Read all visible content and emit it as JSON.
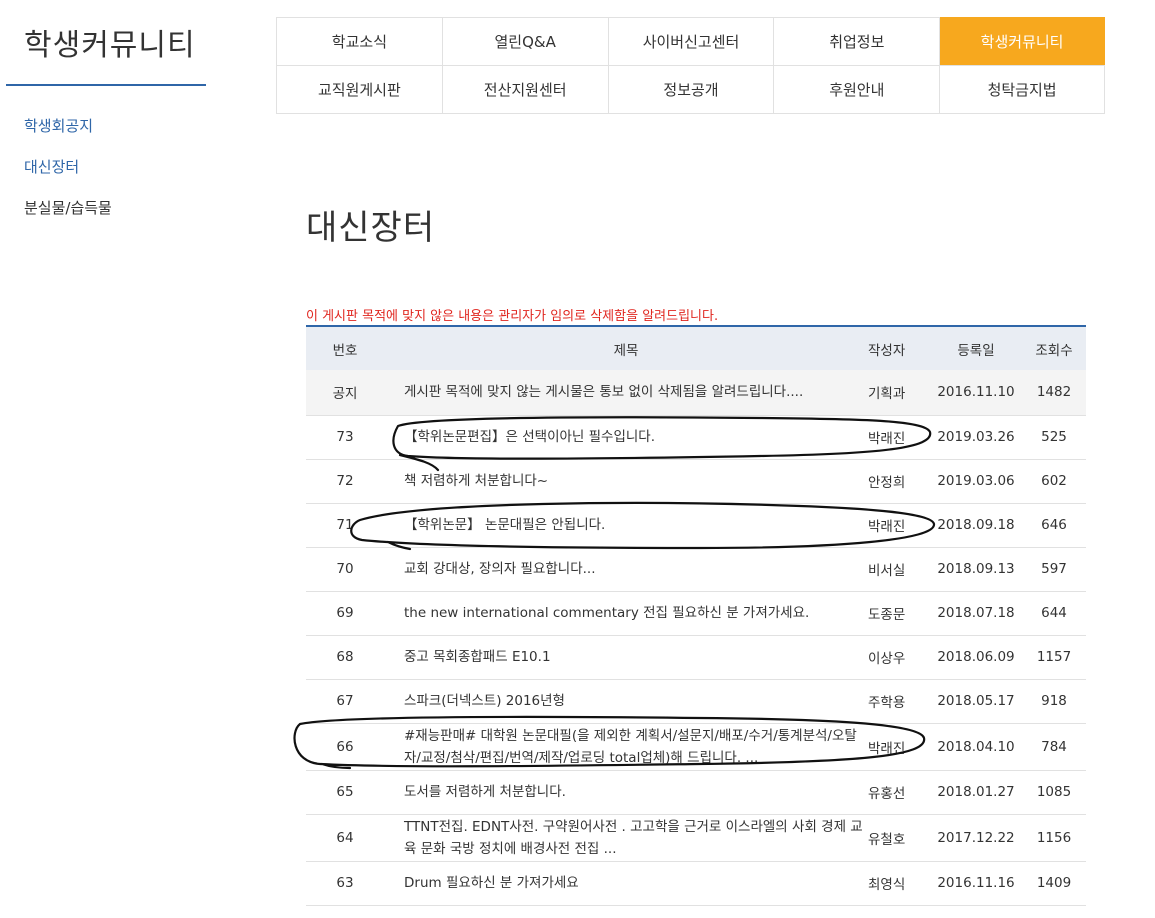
{
  "sidebar": {
    "title": "학생커뮤니티",
    "items": [
      {
        "label": "학생회공지"
      },
      {
        "label": "대신장터"
      },
      {
        "label": "분실물/습득물"
      }
    ]
  },
  "topnav": {
    "row1": [
      {
        "label": "학교소식"
      },
      {
        "label": "열린Q&A"
      },
      {
        "label": "사이버신고센터"
      },
      {
        "label": "취업정보"
      },
      {
        "label": "학생커뮤니티"
      }
    ],
    "row2": [
      {
        "label": "교직원게시판"
      },
      {
        "label": "전산지원센터"
      },
      {
        "label": "정보공개"
      },
      {
        "label": "후원안내"
      },
      {
        "label": "청탁금지법"
      }
    ],
    "active_index": 4
  },
  "page": {
    "title": "대신장터",
    "notice": "이 게시판 목적에 맞지 않은 내용은 관리자가 임의로 삭제함을 알려드립니다."
  },
  "table": {
    "headers": {
      "no": "번호",
      "title": "제목",
      "writer": "작성자",
      "date": "등록일",
      "views": "조회수"
    },
    "rows": [
      {
        "no": "공지",
        "title": "게시판 목적에 맞지 않는 게시물은 통보 없이 삭제됨을 알려드립니다....",
        "writer": "기획과",
        "date": "2016.11.10",
        "views": "1482"
      },
      {
        "no": "73",
        "title": "【학위논문편집】은 선택이아닌 필수입니다.",
        "writer": "박래진",
        "date": "2019.03.26",
        "views": "525"
      },
      {
        "no": "72",
        "title": "책 저렴하게 처분합니다~",
        "writer": "안정희",
        "date": "2019.03.06",
        "views": "602"
      },
      {
        "no": "71",
        "title": "【학위논문】 논문대필은 안됩니다.",
        "writer": "박래진",
        "date": "2018.09.18",
        "views": "646"
      },
      {
        "no": "70",
        "title": "교회 강대상, 장의자 필요합니다...",
        "writer": "비서실",
        "date": "2018.09.13",
        "views": "597"
      },
      {
        "no": "69",
        "title": "the new international commentary 전집 필요하신 분 가져가세요.",
        "writer": "도종문",
        "date": "2018.07.18",
        "views": "644"
      },
      {
        "no": "68",
        "title": "중고 목회종합패드 E10.1",
        "writer": "이상우",
        "date": "2018.06.09",
        "views": "1157"
      },
      {
        "no": "67",
        "title": "스파크(더넥스트) 2016년형",
        "writer": "주학용",
        "date": "2018.05.17",
        "views": "918"
      },
      {
        "no": "66",
        "title": "#재능판매# 대학원 논문대필(을 제외한 계획서/설문지/배포/수거/통계분석/오탈자/교정/첨삭/편집/번역/제작/업로딩 total업체)해 드립니다. ...",
        "writer": "박래진",
        "date": "2018.04.10",
        "views": "784"
      },
      {
        "no": "65",
        "title": "도서를 저렴하게 처분합니다.",
        "writer": "유홍선",
        "date": "2018.01.27",
        "views": "1085"
      },
      {
        "no": "64",
        "title": "TTNT전집. EDNT사전. 구약원어사전 . 고고학을 근거로 이스라엘의 사회 경제 교육 문화 국방 정치에 배경사전 전집 ...",
        "writer": "유철호",
        "date": "2017.12.22",
        "views": "1156"
      },
      {
        "no": "63",
        "title": "Drum 필요하신 분 가져가세요",
        "writer": "최영식",
        "date": "2016.11.16",
        "views": "1409"
      }
    ]
  },
  "colors": {
    "accent": "#f7a81e",
    "link_blue": "#2f66a8",
    "notice_red": "#e0261f"
  }
}
